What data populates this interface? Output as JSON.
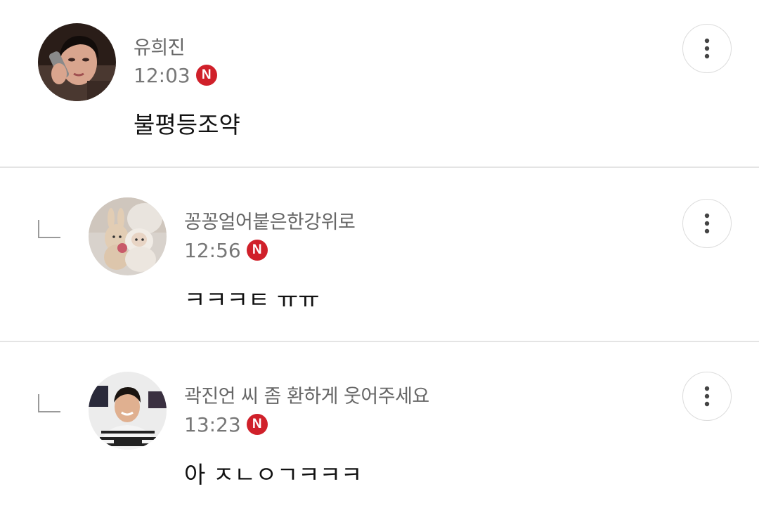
{
  "comments": [
    {
      "author": "유희진",
      "time": "12:03",
      "badge": "N",
      "text": "불평등조약",
      "is_reply": false,
      "avatar_icon": "person-on-phone-avatar"
    },
    {
      "author": "꽁꽁얼어붙은한강위로",
      "time": "12:56",
      "badge": "N",
      "text": "ㅋㅋㅋㅌ ㅠㅠ",
      "is_reply": true,
      "avatar_icon": "plush-toys-avatar"
    },
    {
      "author": "곽진언 씨 좀 환하게 웃어주세요",
      "time": "13:23",
      "badge": "N",
      "text": "아 ㅈㄴㅇㄱㅋㅋㅋ",
      "is_reply": true,
      "avatar_icon": "smiling-man-avatar"
    }
  ],
  "more_icon": "more-vertical-icon",
  "colors": {
    "badge": "#d0202a",
    "author": "#666666",
    "time": "#777777",
    "divider": "#e4e4e4"
  }
}
